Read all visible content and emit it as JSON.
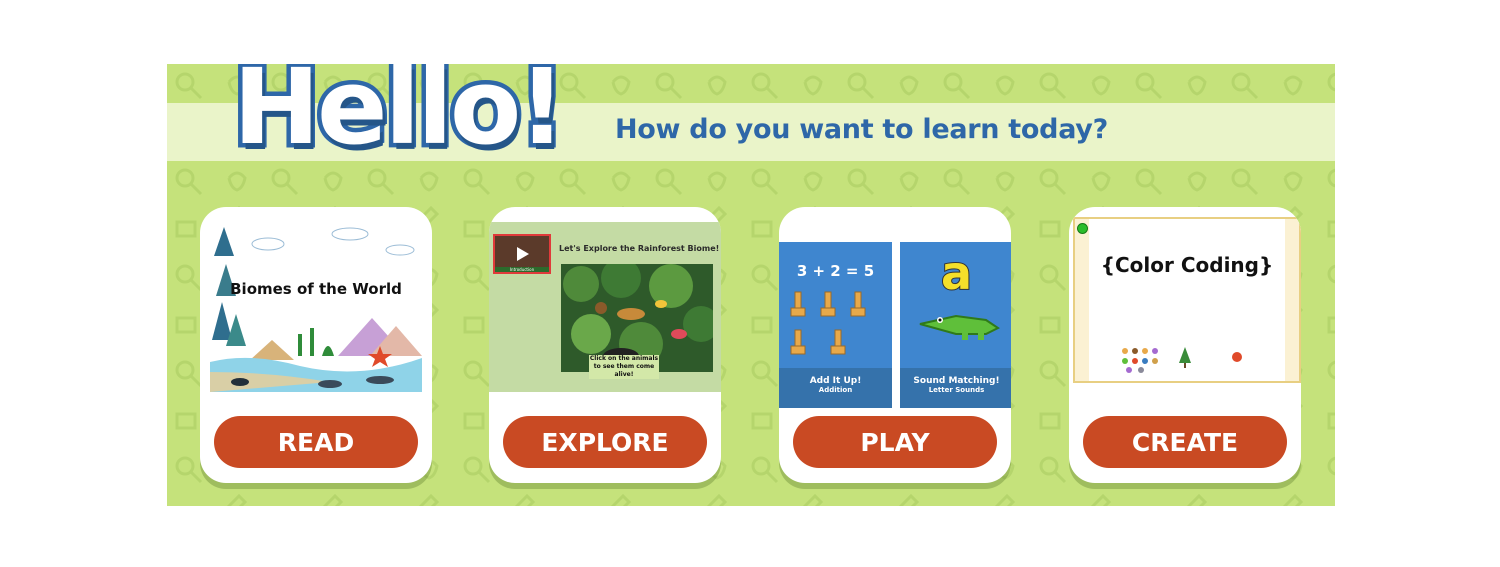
{
  "header": {
    "greeting": "Hello!",
    "tagline": "How do you want to learn today?"
  },
  "cards": [
    {
      "thumbnail_title": "Biomes of the World",
      "button_label": "READ"
    },
    {
      "thumbnail_title": "Let's Explore the Rainforest Biome!",
      "video_label": "Introduction",
      "thumbnail_caption": "Click on the animals to see them come alive!",
      "button_label": "EXPLORE"
    },
    {
      "panels": [
        {
          "display": "3 + 2 = 5",
          "title": "Add It Up!",
          "subtitle": "Addition"
        },
        {
          "display": "a",
          "title": "Sound Matching!",
          "subtitle": "Letter Sounds"
        }
      ],
      "button_label": "PLAY"
    },
    {
      "thumbnail_title": "{Color Coding}",
      "button_label": "CREATE"
    }
  ],
  "colors": {
    "banner_background": "#c5e27b",
    "stripe": "#eaf4c9",
    "title_blue": "#2e67a8",
    "button_red": "#c94a23"
  },
  "icons": [
    "magnifier-icon",
    "wrench-icon",
    "lightbulb-icon",
    "book-icon",
    "puzzle-icon",
    "play-icon",
    "crocodile-icon",
    "giraffe-icon",
    "tree-icon",
    "mountain-icon"
  ]
}
